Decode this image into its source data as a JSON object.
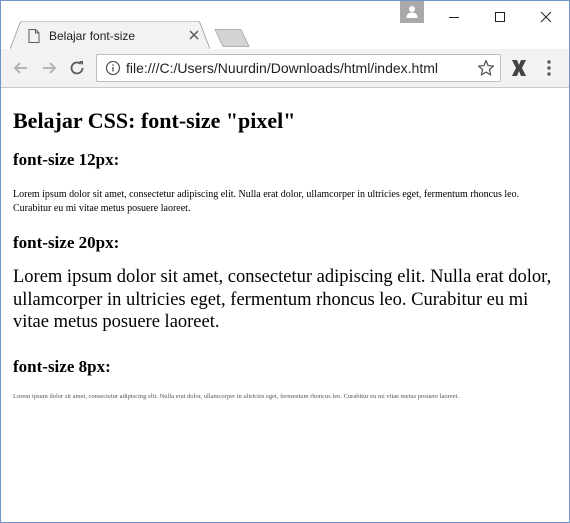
{
  "browser": {
    "tab": {
      "title": "Belajar font-size"
    },
    "address_bar": {
      "url": "file:///C:/Users/Nuurdin/Downloads/html/index.html"
    }
  },
  "page": {
    "heading": "Belajar CSS: font-size \"pixel\"",
    "sections": [
      {
        "heading": "font-size 12px:",
        "text": "Lorem ipsum dolor sit amet, consectetur adipiscing elit. Nulla erat dolor, ullamcorper in ultricies eget, fermentum rhoncus leo. Curabitur eu mi vitae metus posuere laoreet."
      },
      {
        "heading": "font-size 20px:",
        "text": "Lorem ipsum dolor sit amet, consectetur adipiscing elit. Nulla erat dolor, ullamcorper in ultricies eget, fermentum rhoncus leo. Curabitur eu mi vitae metus posuere laoreet."
      },
      {
        "heading": "font-size 8px:",
        "text": "Lorem ipsum dolor sit amet, consectetur adipiscing elit. Nulla erat dolor, ullamcorper in ultricies eget, fermentum rhoncus leo. Curabitur eu mi vitae metus posuere laoreet."
      }
    ]
  },
  "icons": {
    "tab_favicon": "document-icon",
    "tab_close": "close-icon",
    "back": "arrow-left-icon",
    "forward": "arrow-right-icon",
    "reload": "reload-icon",
    "site_info": "info-icon",
    "bookmark": "star-icon",
    "extension": "extension-x-icon",
    "menu": "kebab-menu-icon",
    "profile": "person-icon"
  },
  "colors": {
    "window_border": "#6f95c9",
    "toolbar_bg": "#f2f2f2",
    "tab_bg": "#f2f2f2"
  }
}
